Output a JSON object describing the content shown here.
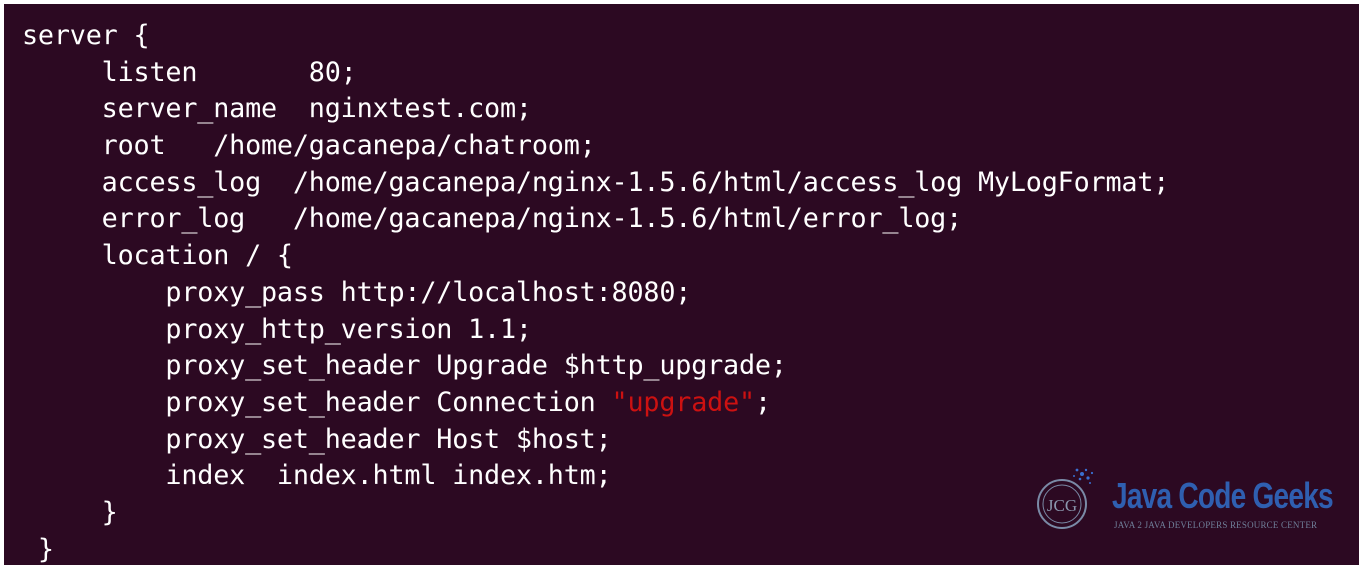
{
  "code_lines": [
    {
      "text": "server {"
    },
    {
      "text": "     listen       80;"
    },
    {
      "text": "     server_name  nginxtest.com;"
    },
    {
      "text": "     root   /home/gacanepa/chatroom;"
    },
    {
      "text": "     access_log  /home/gacanepa/nginx-1.5.6/html/access_log MyLogFormat;"
    },
    {
      "text": "     error_log   /home/gacanepa/nginx-1.5.6/html/error_log;"
    },
    {
      "text": "     location / {"
    },
    {
      "text": "         proxy_pass http://localhost:8080;"
    },
    {
      "text": "         proxy_http_version 1.1;"
    },
    {
      "text": "         proxy_set_header Upgrade $http_upgrade;"
    },
    {
      "pre": "         proxy_set_header Connection ",
      "string": "\"upgrade\"",
      "post": ";"
    },
    {
      "text": "         proxy_set_header Host $host;"
    },
    {
      "text": "         index  index.html index.htm;"
    },
    {
      "text": "     }"
    },
    {
      "text": " }"
    }
  ],
  "watermark": {
    "brand": "Java Code Geeks",
    "tagline": "JAVA 2 JAVA DEVELOPERS RESOURCE CENTER",
    "seal_text": "JCG"
  },
  "colors": {
    "terminal_background": "#2c0922",
    "code_text": "#ffffff",
    "string_literal": "#cc1111",
    "watermark_brand": "#2f5fb0"
  }
}
